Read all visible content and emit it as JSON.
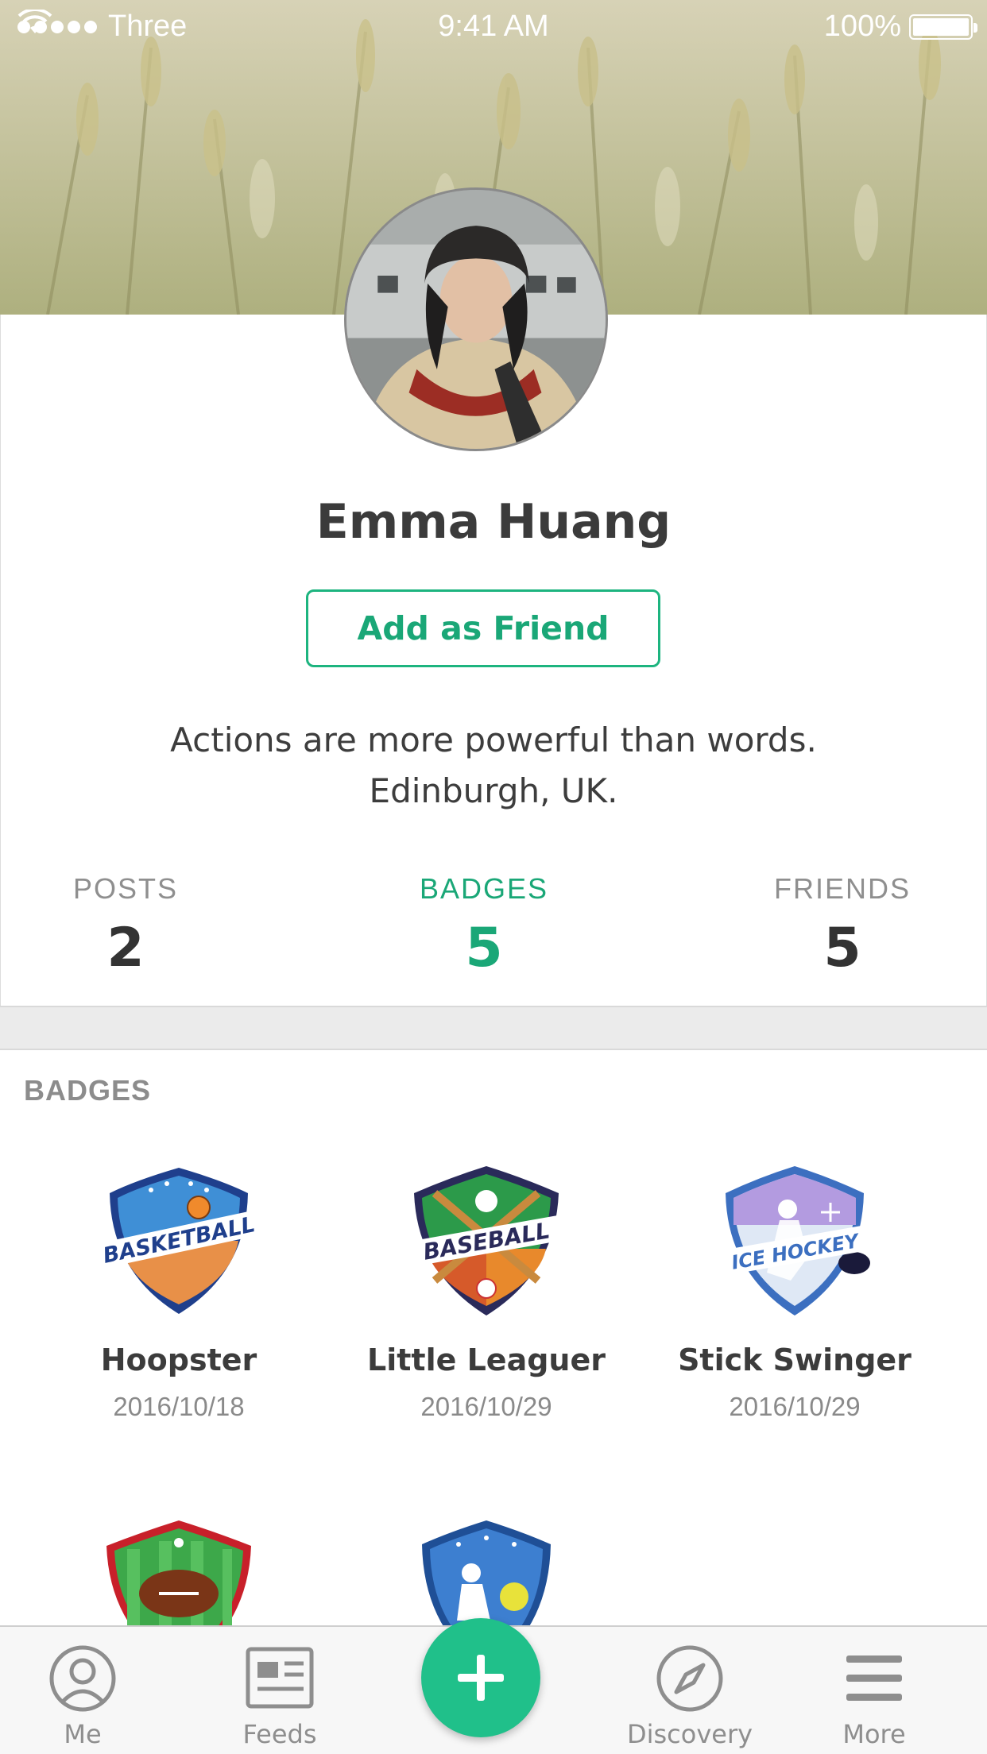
{
  "status_bar": {
    "carrier": "Three",
    "time": "9:41 AM",
    "battery": "100%"
  },
  "profile": {
    "name": "Emma Huang",
    "add_friend_label": "Add as Friend",
    "bio_line1": "Actions are more powerful than words.",
    "bio_line2": "Edinburgh, UK."
  },
  "stats": [
    {
      "label": "POSTS",
      "value": "2"
    },
    {
      "label": "BADGES",
      "value": "5"
    },
    {
      "label": "FRIENDS",
      "value": "5"
    }
  ],
  "badges": {
    "title": "BADGES",
    "items": [
      {
        "name": "Hoopster",
        "date": "2016/10/18",
        "icon": "basketball-badge-icon",
        "emblem": "BASKETBALL"
      },
      {
        "name": "Little Leaguer",
        "date": "2016/10/29",
        "icon": "baseball-badge-icon",
        "emblem": "BASEBALL"
      },
      {
        "name": "Stick Swinger",
        "date": "2016/10/29",
        "icon": "ice-hockey-badge-icon",
        "emblem": "ICE HOCKEY"
      },
      {
        "icon": "football-badge-icon"
      },
      {
        "icon": "tennis-badge-icon"
      }
    ]
  },
  "tab_bar": {
    "me": "Me",
    "feeds": "Feeds",
    "discovery": "Discovery",
    "more": "More"
  },
  "colors": {
    "accent": "#1db47f",
    "text": "#3b3b3b",
    "muted": "#8e8e8e"
  }
}
